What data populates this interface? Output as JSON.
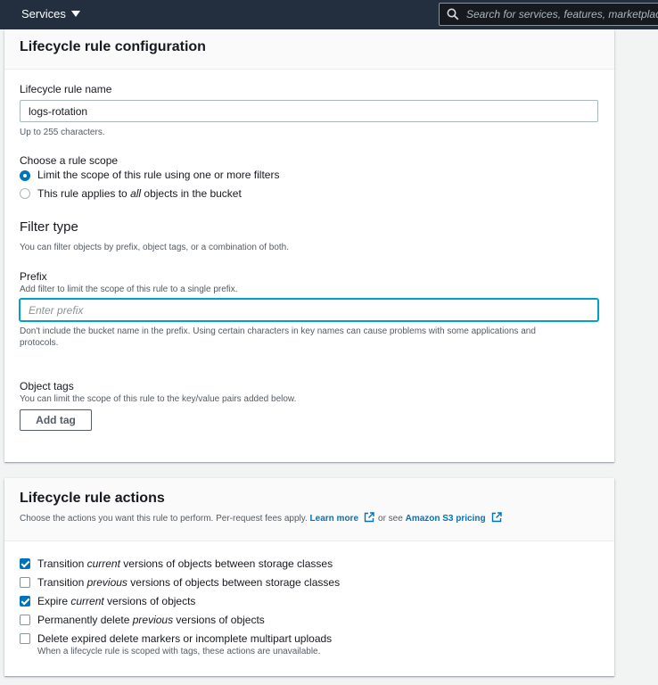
{
  "topbar": {
    "services_label": "Services",
    "search_placeholder": "Search for services, features, marketplace products, and docs"
  },
  "config": {
    "title": "Lifecycle rule configuration",
    "rule_name_label": "Lifecycle rule name",
    "rule_name_value": "logs-rotation",
    "rule_name_hint": "Up to 255 characters.",
    "scope_label": "Choose a rule scope",
    "scope_options": [
      {
        "pre": "Limit the scope of this rule using one or more filters",
        "em": "",
        "post": "",
        "selected": true
      },
      {
        "pre": "This rule applies to ",
        "em": "all",
        "post": " objects in the bucket",
        "selected": false
      }
    ],
    "filter_title": "Filter type",
    "filter_desc": "You can filter objects by prefix, object tags, or a combination of both.",
    "prefix_label": "Prefix",
    "prefix_desc": "Add filter to limit the scope of this rule to a single prefix.",
    "prefix_placeholder": "Enter prefix",
    "prefix_hint_line1": "Don't include the bucket name in the prefix. Using certain characters in key names can cause problems with some applications and",
    "prefix_hint_line2": "protocols.",
    "tags_label": "Object tags",
    "tags_desc": "You can limit the scope of this rule to the key/value pairs added below.",
    "add_tag_label": "Add tag"
  },
  "actions": {
    "title": "Lifecycle rule actions",
    "desc": "Choose the actions you want this rule to perform. Per-request fees apply.",
    "learn_more": "Learn more",
    "or_see": "or see",
    "pricing_link": "Amazon S3 pricing",
    "items": [
      {
        "pre": "Transition ",
        "em": "current",
        "post": " versions of objects between storage classes",
        "checked": true
      },
      {
        "pre": "Transition ",
        "em": "previous",
        "post": " versions of objects between storage classes",
        "checked": false
      },
      {
        "pre": "Expire ",
        "em": "current",
        "post": " versions of objects",
        "checked": true
      },
      {
        "pre": "Permanently delete ",
        "em": "previous",
        "post": " versions of objects",
        "checked": false
      },
      {
        "pre": "Delete expired delete markers or incomplete multipart uploads",
        "em": "",
        "post": "",
        "checked": false
      }
    ],
    "items_note": "When a lifecycle rule is scoped with tags, these actions are unavailable."
  },
  "colors": {
    "topbar_bg": "#232f3e",
    "accent": "#0073bb",
    "focus": "#00a1c9"
  }
}
